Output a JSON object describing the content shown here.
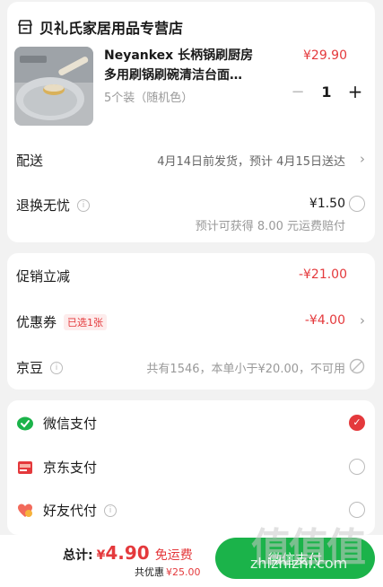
{
  "store": {
    "name": "贝礼氏家居用品专营店",
    "icon": "store-icon"
  },
  "product": {
    "title_line1": "Neyankex 长柄锅刷厨房",
    "title_line2": "多用刷锅刷碗清洁台面…",
    "spec": "5个装（随机色）",
    "price": "¥29.90",
    "quantity": "1",
    "minus": "−",
    "plus": "+"
  },
  "shipping": {
    "label": "配送",
    "text": "4月14日前发货，预计 4月15日送达"
  },
  "returns": {
    "label": "退换无忧",
    "price": "¥1.50",
    "note": "预计可获得 8.00 元运费赔付"
  },
  "promo": {
    "label": "促销立减",
    "value": "-¥21.00"
  },
  "coupon": {
    "label": "优惠券",
    "tag": "已选1张",
    "value": "-¥4.00"
  },
  "beans": {
    "label": "京豆",
    "text": "共有1546，本单小于¥20.00，不可用"
  },
  "payment": {
    "options": [
      {
        "label": "微信支付",
        "icon": "wechat-pay-icon",
        "selected": true
      },
      {
        "label": "京东支付",
        "icon": "jd-pay-icon",
        "selected": false
      },
      {
        "label": "好友代付",
        "icon": "friend-pay-icon",
        "selected": false
      }
    ]
  },
  "footer": {
    "total_label": "总计:",
    "currency": "¥",
    "amount": "4.90",
    "free_shipping": "免运费",
    "saved_label": "共优惠",
    "saved_amount": "¥25.00",
    "pay_button": "微信支付"
  },
  "watermark": {
    "text": "值值值",
    "url": "zhizhizhi.com"
  },
  "colors": {
    "accent": "#e4393c",
    "wechat_green": "#1bb34a",
    "background": "#f2f2f2"
  }
}
